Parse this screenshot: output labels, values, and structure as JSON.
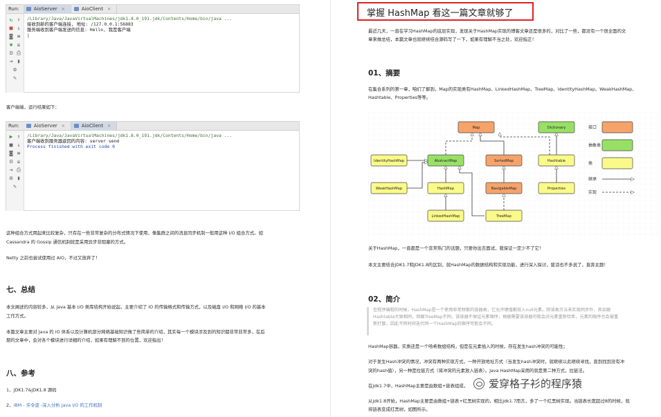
{
  "left": {
    "ide1": {
      "run_label": "Run:",
      "tabs": [
        "AioServer",
        "AioClient"
      ],
      "lines": [
        "/Library/Java/JavaVirtualMachines/jdk1.8.0_191.jdk/Contents/Home/bin/java ...",
        "接收到新的客户端连接, 地址: /127.0.0.1:56883",
        "服务端收到客户端发送的信息: Hello, 我是客户端"
      ]
    },
    "caption_client": "客户端端，运行结果如下：",
    "ide2": {
      "run_label": "Run:",
      "tabs": [
        "AioServer",
        "AioClient"
      ],
      "lines": [
        "/Library/Java/JavaVirtualMachines/jdk1.8.0_191.jdk/Contents/Home/bin/java ...",
        "客户端收到服务器返回的内容: server send",
        "",
        "Process finished with exit code 0"
      ]
    },
    "para1_l1": "这种组合方式用起来比较复杂，只有在一些非常复杂的分布式情况下使用，像集群之间的消息同步机制一般用这种 I/O 组合方式。如",
    "para1_l2": "Cassandra 的 Gossip 通信机制就是采用异步非阻塞的方式。",
    "para2": "Netty 之前也尝试使用过 AIO，不过又放弃了！",
    "h_summary": "七、总结",
    "sum1_l1": "本文阐述的内容较多，从 Java 基本 I/O 类库结构开始说起，主要介绍了 IO 的传输格式和传输方式，以及磁盘 I/O 和网络 I/O 的基本",
    "sum1_l2": "工作方式。",
    "sum2_l1": "本篇文章主要对 Java 的 IO 体系以及计算机部分网络基础知识做了些简单的介绍，其实每一个模块涉及到的知识都非常非常多，在后",
    "sum2_l2": "期的文章中，会对各个模块进行详细的介绍，如果有理解不到的位置，欢迎指出！",
    "h_ref": "八、参考",
    "ref1": "1、JDK1.7&JDK1.8 源码",
    "ref2_prefix": "2、",
    "ref2_link": "IBM - 许令波 -深入分析 Java I/O 的工作机制"
  },
  "right": {
    "title": "掌握 HashMap 看这一篇文章就够了",
    "intro_l1": "最近几天，一直在学习HashMap的底层实现，发现关于HashMap实现的博客文章还是很多的，对比了一些，都没有一个很全面的文",
    "intro_l2": "章来做总结，本篇文章也就继续结合源码写了一下，如果有理解不当之处，欢迎指正！",
    "h_summary": "01、摘要",
    "sum_l1": "在集合系列的第一章，咱们了解到，Map的实现类有HashMap、LinkedHashMap、TreeMap、IdentityHashMap、WeakHashMap、",
    "sum_l2": "Hashtable、Properties等等。",
    "diagram": {
      "nodes": {
        "map": "Map",
        "dictionary": "Dictionary",
        "identity": "IdentityHashMap",
        "abstract": "AbstractMap",
        "sortedmap": "SortedMap",
        "hashtable": "Hashtable",
        "weak": "WeakHashMap",
        "hashmap": "HashMap",
        "navigable": "NavigableMap",
        "properties": "Properties",
        "linked": "LinkedHashMap",
        "treemap": "TreeMap"
      },
      "legend": {
        "interface": "接口",
        "abstract": "抽象类",
        "class": "类",
        "inherit": "继承",
        "implement": "实现"
      },
      "colors": {
        "interface": "#f5a36a",
        "abstract": "#98e065",
        "class": "#fafa8a"
      }
    },
    "p_about_l1": "关于HashMap，一直都是一个非常热门的话题，只要你出去面试，我保证一定少不了它！",
    "p_about_l2": "本文主要结合JDK1.7和JDK1.8的区别，就HashMap的数据结构和实现功能，进行深入探讨，废话也不多说了，直奔主题！",
    "h_intro": "02、简介",
    "quote_l1": "在程序编程的时候，HashMap是一个使用非常频繁的容器类，它允许键值都放入null元素。除该类方法未实现同步外，其余跟",
    "quote_l2": "Hashtable大致相同，但跟TreeMap不同，该容器不保证元素顺序，根据需要该容器可能会对元素重新哈希，元素的顺序也会被重",
    "quote_l3": "新打散，因此不同时间迭代同一个HashMap的顺序可能会不同。",
    "p_container": "HashMap容器，实质还是一个哈希数组结构，但是在元素插入的时候，存在发生hash冲突的可能性；",
    "p_conflict_l1": "对于发生Hash冲突的情况，冲突有两种实现方式，一种开放地址方式（当发生hash冲突时，就继续以此继续寻找，直到找到没有冲",
    "p_conflict_l2": "突的hash值），另一种是拉链方式（将冲突的元素放入链表）。Java HashMap采用的就是第二种方式，拉链法。",
    "p_jdk17": "在jdk1.7中，HashMap主要是由数组+链表组成，当发生hash冲突的时候，就将冲突的元素放入链表中。",
    "p_jdk18_l1": "从jdk1.8开始，HashMap主要是由数组+链表+红黑树实现的，相比jdk1.7而言，多了一个红黑树实现。当链表长度超过8的时候，就",
    "p_jdk18_l2": "将链表变成红黑树，如图所示。",
    "watermark": "爱穿格子衫的程序猿"
  }
}
